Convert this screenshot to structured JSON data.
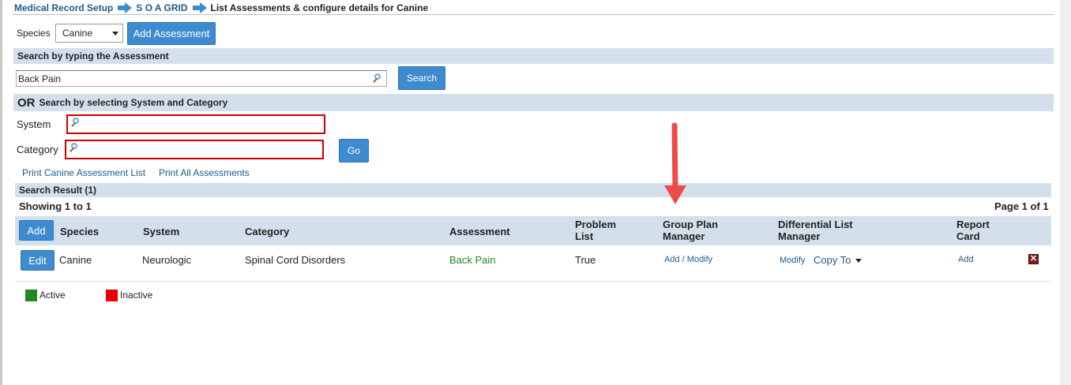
{
  "breadcrumb": {
    "items": [
      "Medical Record Setup",
      "S O A GRID"
    ],
    "current": "List Assessments & configure details for Canine"
  },
  "toolbar": {
    "species_label": "Species",
    "species_value": "Canine",
    "add_assessment_label": "Add Assessment"
  },
  "search_typing": {
    "header": "Search by typing the Assessment",
    "value": "Back Pain",
    "search_label": "Search"
  },
  "search_select": {
    "header_or": "OR",
    "header_text": "Search by selecting System and Category",
    "system_label": "System",
    "category_label": "Category",
    "go_label": "Go"
  },
  "links": {
    "print_list": "Print Canine Assessment List",
    "print_all": "Print All Assessments"
  },
  "results": {
    "header": "Search Result (1)",
    "showing": "Showing 1 to 1",
    "page": "Page 1 of 1",
    "add_label": "Add",
    "columns": {
      "species": "Species",
      "system": "System",
      "category": "Category",
      "assessment": "Assessment",
      "problem_list_1": "Problem",
      "problem_list_2": "List",
      "group_plan_1": "Group Plan",
      "group_plan_2": "Manager",
      "diff_list_1": "Differential List",
      "diff_list_2": "Manager",
      "report_card_1": "Report",
      "report_card_2": "Card"
    },
    "rows": [
      {
        "edit_label": "Edit",
        "species": "Canine",
        "system": "Neurologic",
        "category": "Spinal Cord Disorders",
        "assessment": "Back Pain",
        "problem_list": "True",
        "group_plan": "Add / Modify",
        "diff_modify": "Modify",
        "copy_to": "Copy To",
        "report_card": "Add"
      }
    ]
  },
  "legend": {
    "active": "Active",
    "active_color": "#1e8a1e",
    "inactive": "Inactive",
    "inactive_color": "#e60000"
  },
  "annotation": {
    "arrow_color": "#ef4a4a"
  }
}
